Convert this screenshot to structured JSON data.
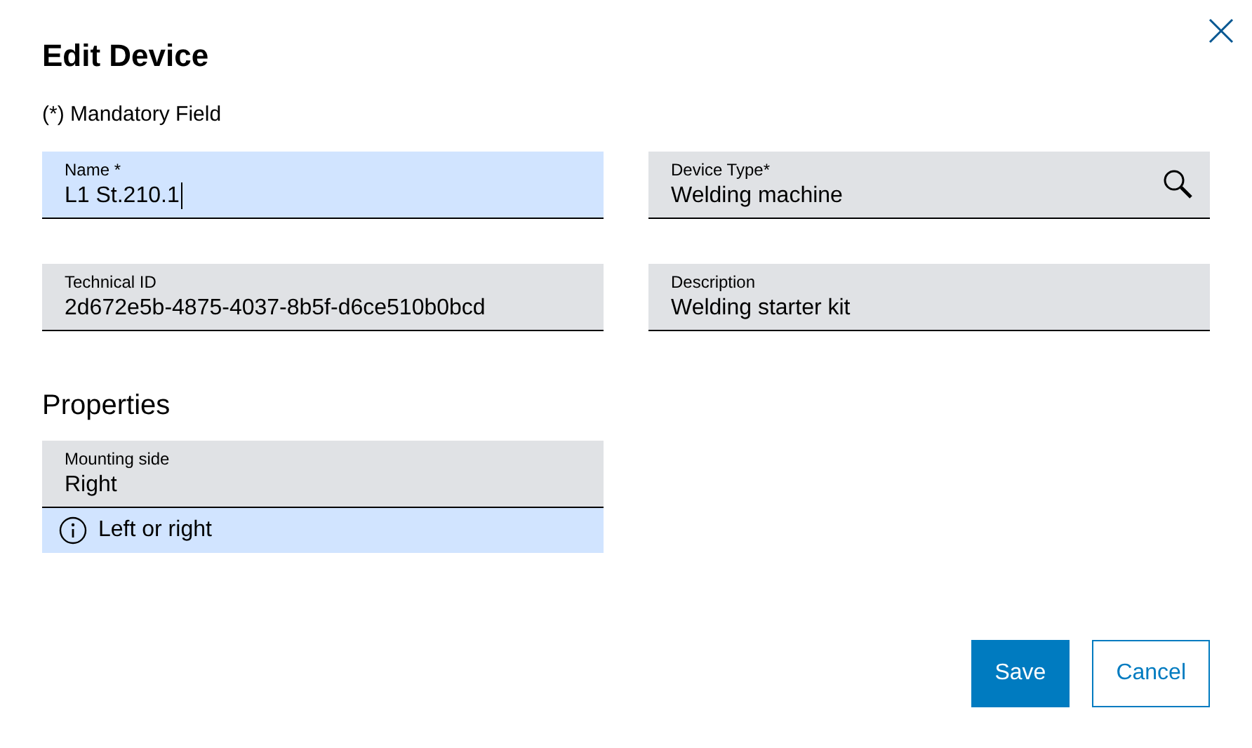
{
  "dialog": {
    "title": "Edit Device",
    "mandatory_note": "(*) Mandatory Field"
  },
  "fields": [
    {
      "label": "Name *",
      "value": "L1 St.210.1",
      "kind": "text",
      "focused": true
    },
    {
      "label": "Device Type*",
      "value": "Welding machine",
      "kind": "lookup",
      "focused": false
    },
    {
      "label": "Technical ID",
      "value": "2d672e5b-4875-4037-8b5f-d6ce510b0bcd",
      "kind": "text",
      "focused": false
    },
    {
      "label": "Description",
      "value": "Welding starter kit",
      "kind": "text",
      "focused": false
    }
  ],
  "properties": {
    "heading": "Properties",
    "fields": [
      {
        "label": "Mounting side",
        "value": "Right",
        "kind": "text",
        "focused": false,
        "hint": "Left or right"
      }
    ]
  },
  "buttons": [
    {
      "label": "Save",
      "kind": "primary"
    },
    {
      "label": "Cancel",
      "kind": "secondary"
    }
  ]
}
